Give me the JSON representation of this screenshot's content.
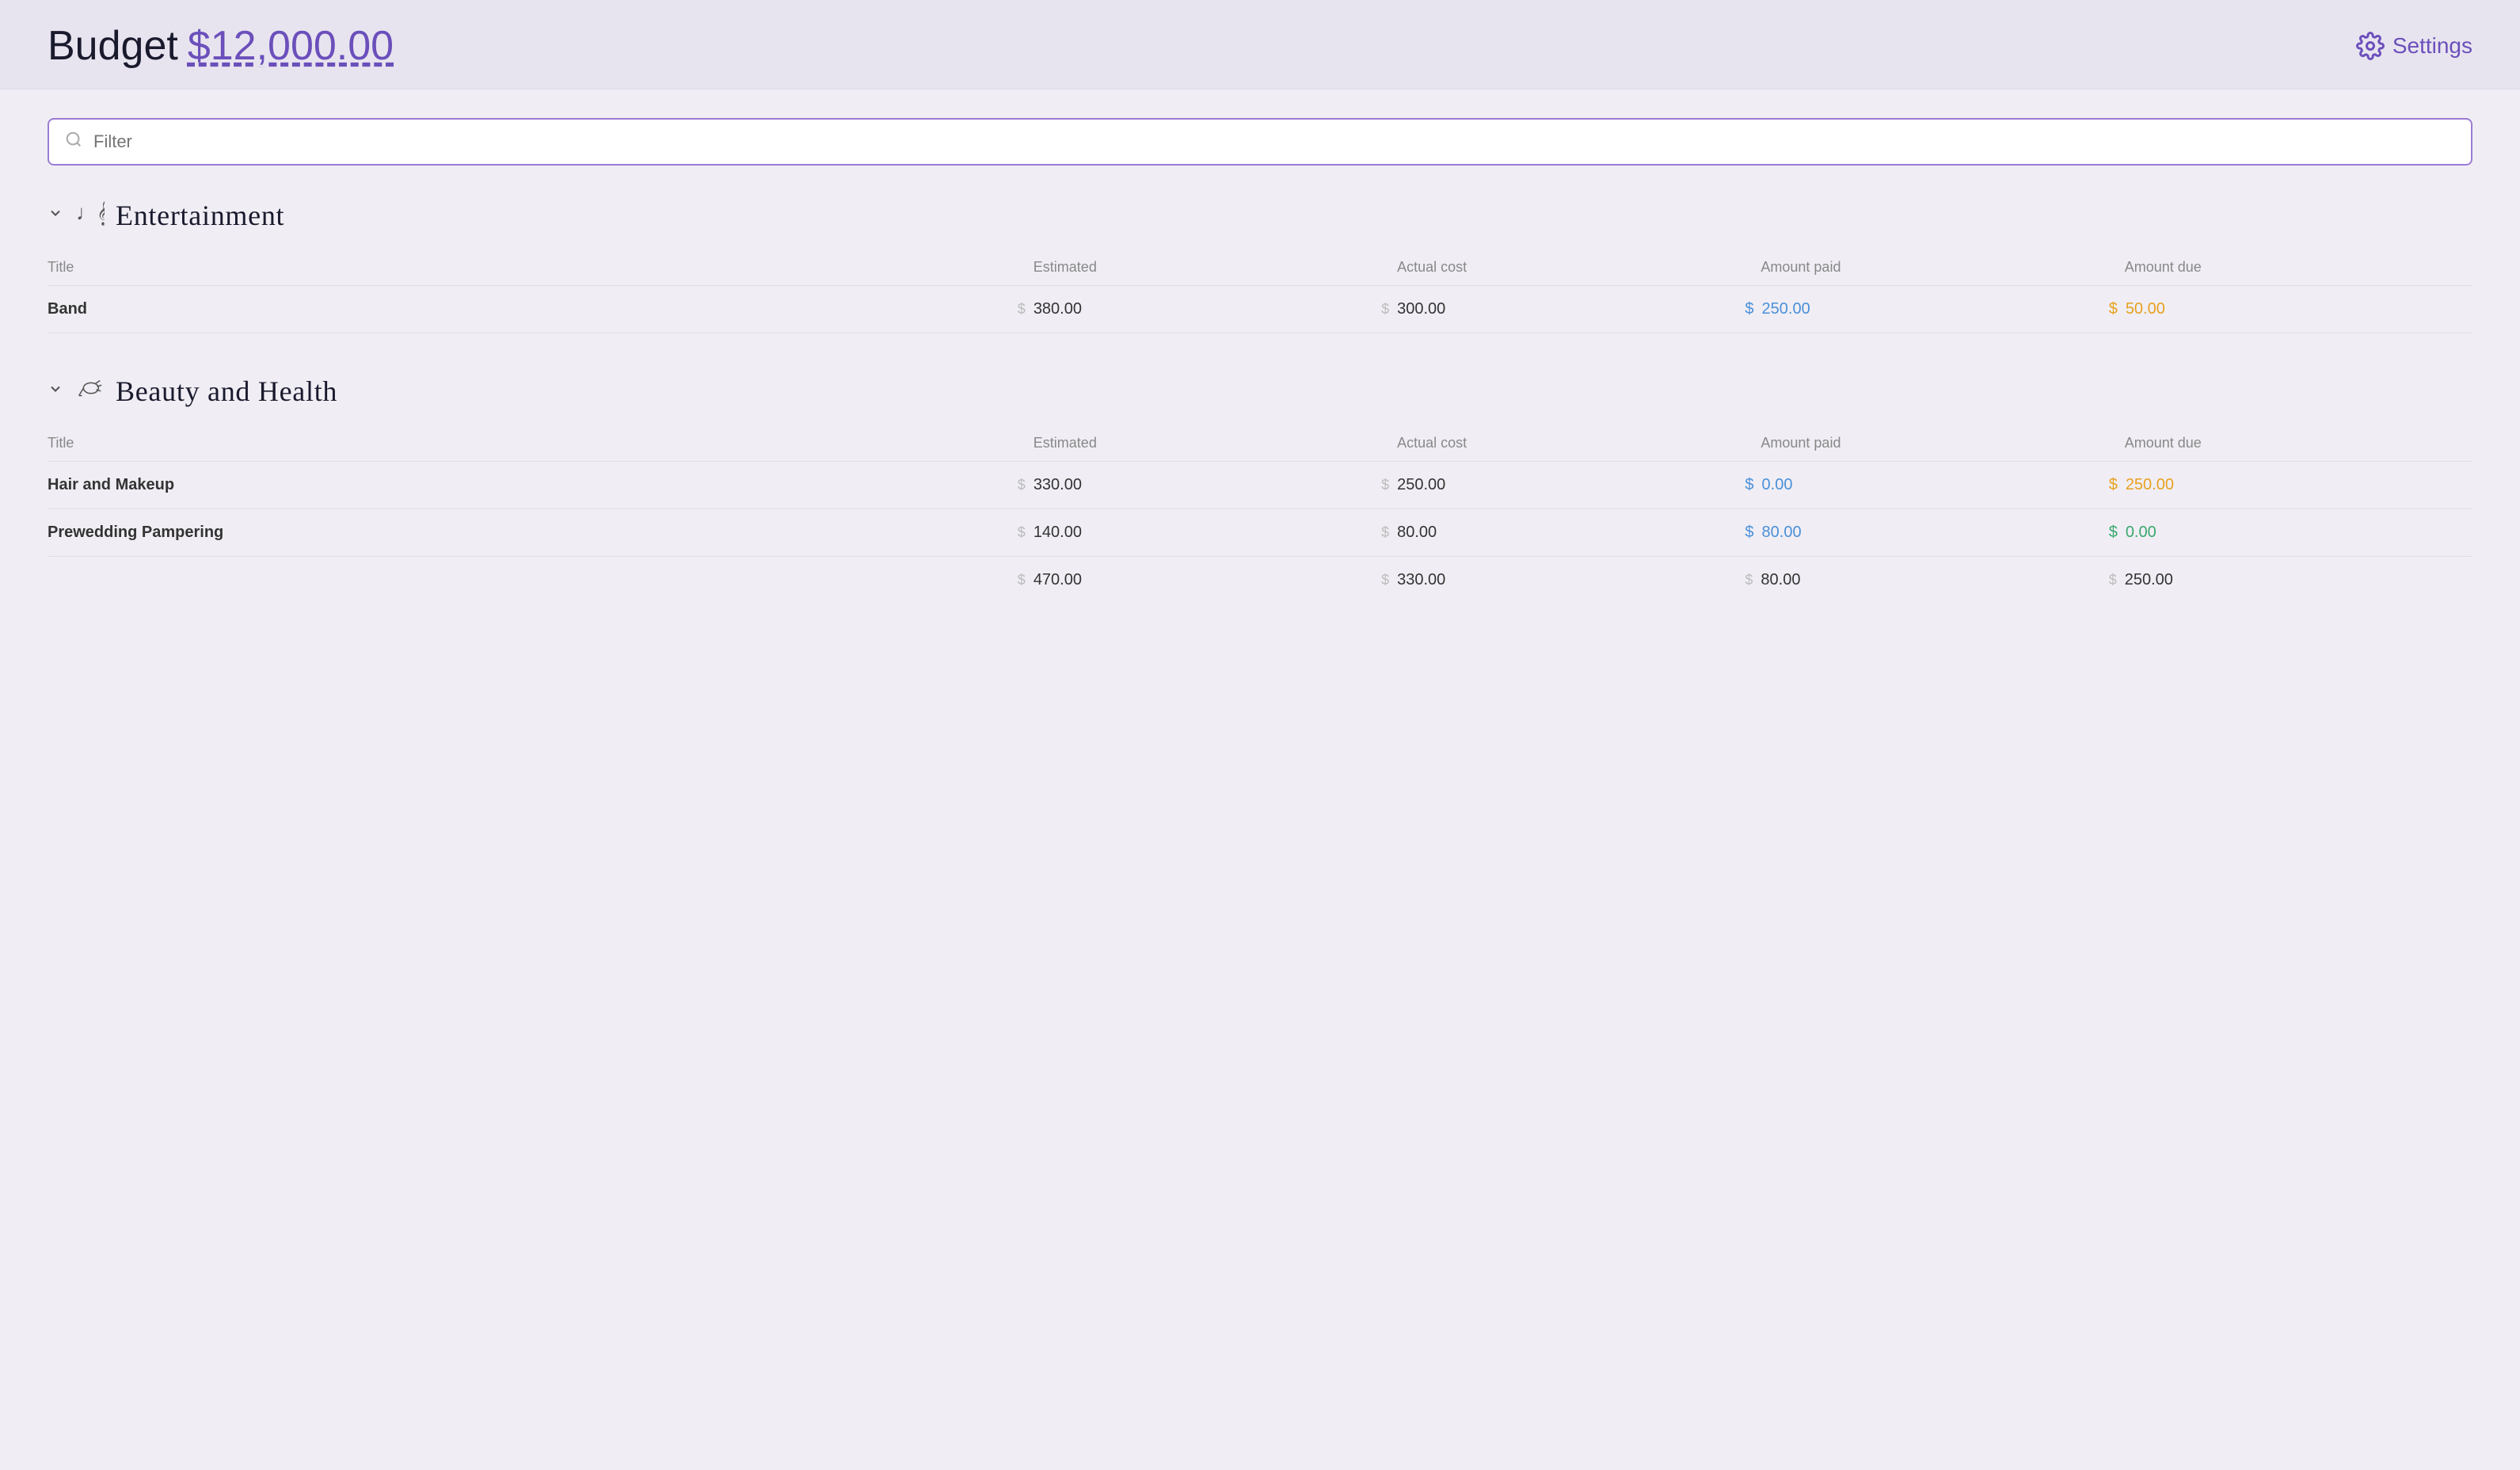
{
  "header": {
    "title_prefix": "Budget",
    "budget_amount": "$12,000.00",
    "settings_label": "Settings"
  },
  "filter": {
    "placeholder": "Filter"
  },
  "categories": [
    {
      "id": "entertainment",
      "icon": "♩𝄞",
      "name": "Entertainment",
      "columns": {
        "title": "Title",
        "estimated": "Estimated",
        "actual_cost": "Actual cost",
        "amount_paid": "Amount paid",
        "amount_due": "Amount due"
      },
      "items": [
        {
          "title": "Band",
          "estimated": "380.00",
          "actual_cost": "300.00",
          "amount_paid": "250.00",
          "amount_due": "50.00",
          "amount_paid_color": "blue",
          "amount_due_color": "orange"
        }
      ]
    },
    {
      "id": "beauty-and-health",
      "icon": "💨",
      "name": "Beauty and Health",
      "columns": {
        "title": "Title",
        "estimated": "Estimated",
        "actual_cost": "Actual cost",
        "amount_paid": "Amount paid",
        "amount_due": "Amount due"
      },
      "items": [
        {
          "title": "Hair and Makeup",
          "estimated": "330.00",
          "actual_cost": "250.00",
          "amount_paid": "0.00",
          "amount_due": "250.00",
          "amount_paid_color": "blue",
          "amount_due_color": "orange"
        },
        {
          "title": "Prewedding Pampering",
          "estimated": "140.00",
          "actual_cost": "80.00",
          "amount_paid": "80.00",
          "amount_due": "0.00",
          "amount_paid_color": "blue",
          "amount_due_color": "green"
        }
      ],
      "totals": {
        "estimated": "470.00",
        "actual_cost": "330.00",
        "amount_paid": "80.00",
        "amount_due": "250.00"
      }
    }
  ]
}
